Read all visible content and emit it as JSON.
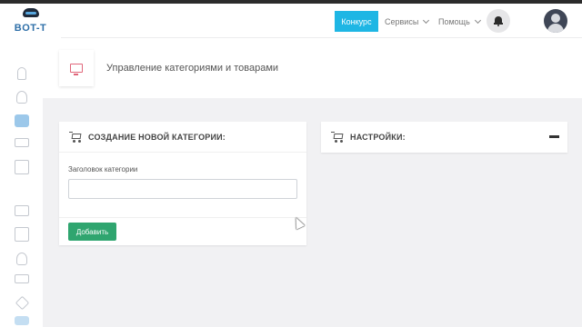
{
  "brand": {
    "logo_text": "BOT-T"
  },
  "topbar": {
    "contest_label": "Конкурс",
    "services_label": "Сервисы",
    "help_label": "Помощь",
    "accent_color": "#1eb6e4"
  },
  "sidebar": {
    "items": [
      {
        "icon": "bell-icon"
      },
      {
        "icon": "users-icon"
      },
      {
        "icon": "briefcase-icon",
        "active": true
      },
      {
        "icon": "monitor-icon"
      },
      {
        "icon": "building-icon"
      },
      {
        "icon": "calendar-icon"
      },
      {
        "icon": "chart-icon"
      },
      {
        "icon": "users-icon"
      },
      {
        "icon": "laptop-icon"
      },
      {
        "icon": "tag-icon"
      },
      {
        "icon": "grid-icon"
      }
    ]
  },
  "page_header": {
    "title": "Управление категориями и товарами",
    "icon": "monitor-icon"
  },
  "new_category_card": {
    "title": "СОЗДАНИЕ НОВОЙ КАТЕГОРИИ:",
    "field_label": "Заголовок категории",
    "field_value": "",
    "add_button": "Добавить",
    "button_color": "#2fa56f"
  },
  "settings_card": {
    "title": "НАСТРОЙКИ:"
  }
}
